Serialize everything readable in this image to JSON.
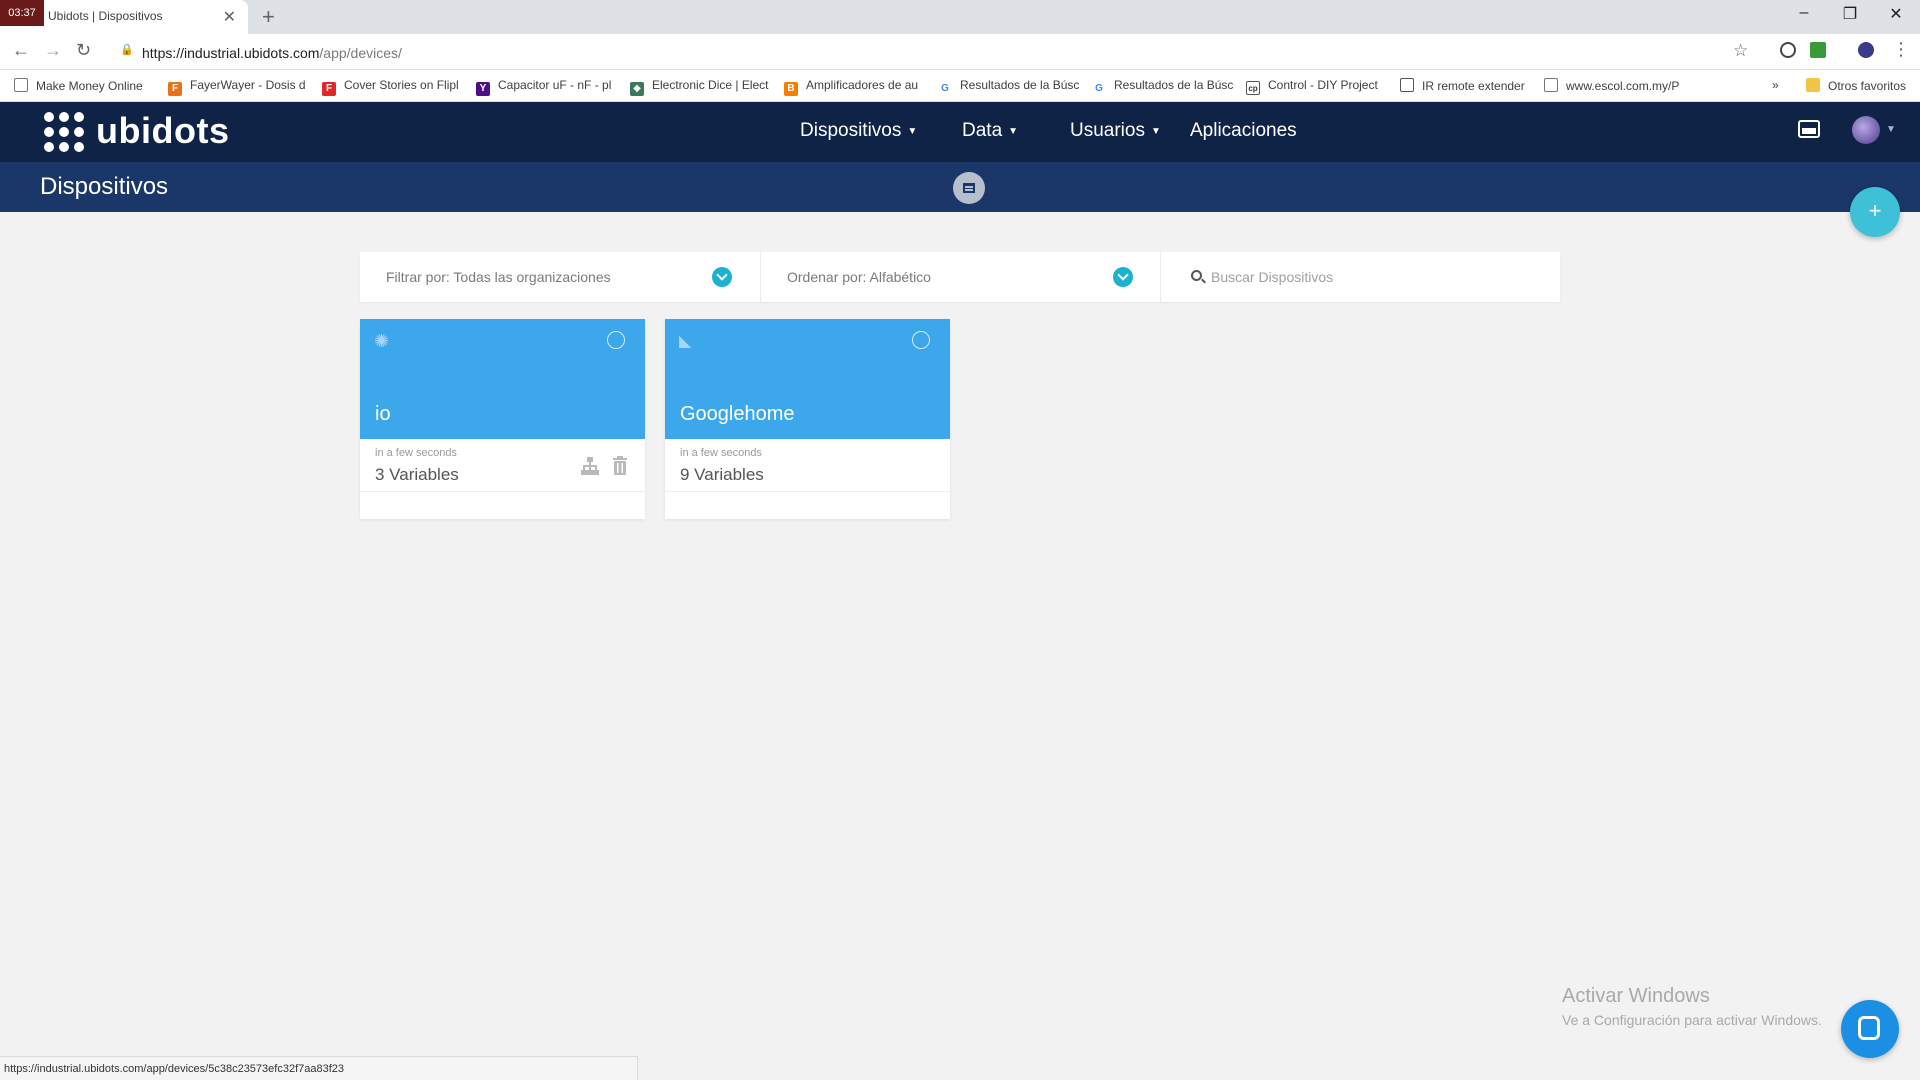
{
  "browser": {
    "tab_time": "03:37",
    "tab_title": "Ubidots | Dispositivos",
    "url_host": "https://industrial.ubidots.com",
    "url_path": "/app/devices/",
    "bookmarks": [
      "Make Money Online",
      "FayerWayer - Dosis d",
      "Cover Stories on Flipl",
      "Capacitor uF - nF - pl",
      "Electronic Dice | Elect",
      "Amplificadores de au",
      "Resultados de la Búsc",
      "Resultados de la Búsc",
      "Control - DIY Project",
      "IR remote extender",
      "www.escol.com.my/P"
    ],
    "bookmarks_overflow": "»",
    "other_bookmarks": "Otros favoritos",
    "status_url": "https://industrial.ubidots.com/app/devices/5c38c23573efc32f7aa83f23"
  },
  "app": {
    "brand": "ubidots",
    "nav": {
      "devices": "Dispositivos",
      "data": "Data",
      "users": "Usuarios",
      "apps": "Aplicaciones"
    },
    "page_title": "Dispositivos",
    "add_button": "+",
    "filter": {
      "organization": "Filtrar por: Todas las organizaciones",
      "sort": "Ordenar por: Alfabético",
      "search_placeholder": "Buscar Dispositivos"
    },
    "devices": [
      {
        "name": "io",
        "icon": "chip-icon",
        "last_activity": "in a few seconds",
        "variables": "3 Variables"
      },
      {
        "name": "Googlehome",
        "icon": "rss-icon",
        "last_activity": "in a few seconds",
        "variables": "9 Variables"
      }
    ]
  },
  "os": {
    "activate_title": "Activar Windows",
    "activate_sub": "Ve a Configuración para activar Windows."
  },
  "colors": {
    "header": "#0f2346",
    "subheader": "#1b3668",
    "card_accent": "#3da7ec",
    "teal": "#1ab2cf"
  }
}
